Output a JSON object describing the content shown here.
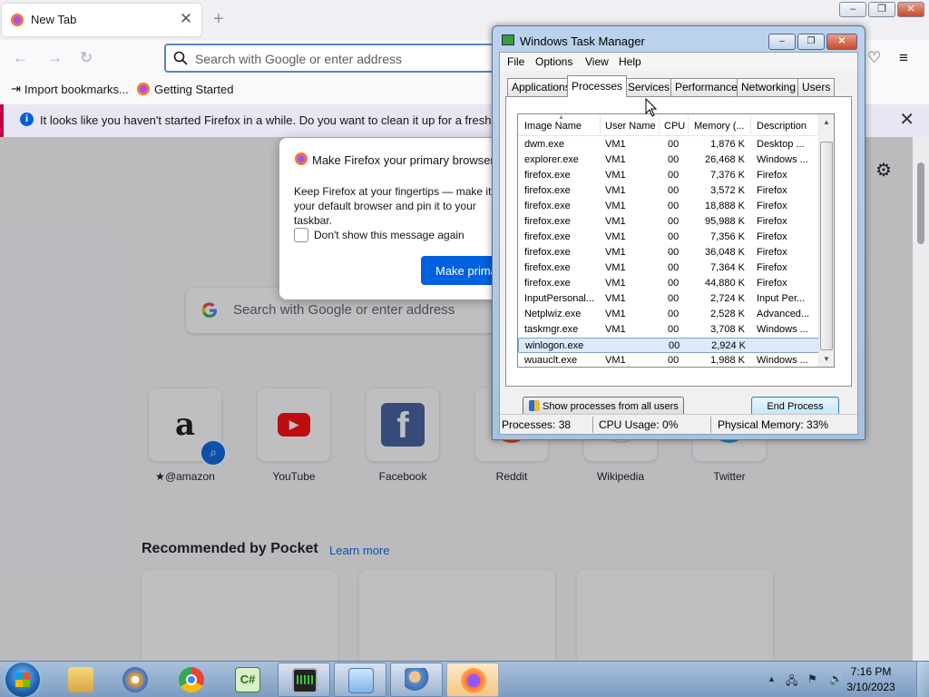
{
  "browser": {
    "tab_title": "New Tab",
    "url_placeholder": "Search with Google or enter address",
    "bookmarks": [
      {
        "label": "Import bookmarks..."
      },
      {
        "label": "Getting Started"
      }
    ],
    "notification": "It looks like you haven't started Firefox in a while. Do you want to clean it up for a fresh, like-new",
    "home_search_placeholder": "Search with Google or enter address",
    "top_sites": [
      {
        "label": "@amazon",
        "icon": "amazon-logo"
      },
      {
        "label": "YouTube",
        "icon": "youtube-logo"
      },
      {
        "label": "Facebook",
        "icon": "facebook-logo"
      },
      {
        "label": "Reddit",
        "icon": "reddit-logo"
      },
      {
        "label": "Wikipedia",
        "icon": "wikipedia-logo"
      },
      {
        "label": "Twitter",
        "icon": "twitter-logo"
      }
    ],
    "pocket": {
      "heading": "Recommended by Pocket",
      "learn_more": "Learn more"
    },
    "dialog": {
      "title": "Make Firefox your primary browser?",
      "body": "Keep Firefox at your fingertips — make it your default browser and pin it to your taskbar.",
      "checkbox_label": "Don't show this message again",
      "primary_button": "Make primary browser"
    }
  },
  "task_manager": {
    "title": "Windows Task Manager",
    "menu": [
      "File",
      "Options",
      "View",
      "Help"
    ],
    "tabs": [
      "Applications",
      "Processes",
      "Services",
      "Performance",
      "Networking",
      "Users"
    ],
    "active_tab": "Processes",
    "columns": [
      "Image Name",
      "User Name",
      "CPU",
      "Memory (...",
      "Description"
    ],
    "processes": [
      {
        "name": "dwm.exe",
        "user": "VM1",
        "cpu": "00",
        "memory": "1,876 K",
        "description": "Desktop ..."
      },
      {
        "name": "explorer.exe",
        "user": "VM1",
        "cpu": "00",
        "memory": "26,468 K",
        "description": "Windows ..."
      },
      {
        "name": "firefox.exe",
        "user": "VM1",
        "cpu": "00",
        "memory": "7,376 K",
        "description": "Firefox"
      },
      {
        "name": "firefox.exe",
        "user": "VM1",
        "cpu": "00",
        "memory": "3,572 K",
        "description": "Firefox"
      },
      {
        "name": "firefox.exe",
        "user": "VM1",
        "cpu": "00",
        "memory": "18,888 K",
        "description": "Firefox"
      },
      {
        "name": "firefox.exe",
        "user": "VM1",
        "cpu": "00",
        "memory": "95,988 K",
        "description": "Firefox"
      },
      {
        "name": "firefox.exe",
        "user": "VM1",
        "cpu": "00",
        "memory": "7,356 K",
        "description": "Firefox"
      },
      {
        "name": "firefox.exe",
        "user": "VM1",
        "cpu": "00",
        "memory": "36,048 K",
        "description": "Firefox"
      },
      {
        "name": "firefox.exe",
        "user": "VM1",
        "cpu": "00",
        "memory": "7,364 K",
        "description": "Firefox"
      },
      {
        "name": "firefox.exe",
        "user": "VM1",
        "cpu": "00",
        "memory": "44,880 K",
        "description": "Firefox"
      },
      {
        "name": "InputPersonal...",
        "user": "VM1",
        "cpu": "00",
        "memory": "2,724 K",
        "description": "Input Per..."
      },
      {
        "name": "Netplwiz.exe",
        "user": "VM1",
        "cpu": "00",
        "memory": "2,528 K",
        "description": "Advanced..."
      },
      {
        "name": "taskmgr.exe",
        "user": "VM1",
        "cpu": "00",
        "memory": "3,708 K",
        "description": "Windows ..."
      },
      {
        "name": "winlogon.exe",
        "user": "",
        "cpu": "00",
        "memory": "2,924 K",
        "description": "",
        "selected": true
      },
      {
        "name": "wuauclt.exe",
        "user": "VM1",
        "cpu": "00",
        "memory": "1,988 K",
        "description": "Windows ..."
      }
    ],
    "show_all_button": "Show processes from all users",
    "end_process_button": "End Process",
    "status": {
      "processes": "Processes: 38",
      "cpu": "CPU Usage: 0%",
      "memory": "Physical Memory: 33%"
    }
  },
  "taskbar": {
    "apps": [
      "start-orb",
      "explorer",
      "media-player",
      "chrome",
      "csharp-editor",
      "remote-desktop",
      "control-panel",
      "user-accounts",
      "firefox"
    ],
    "clock": {
      "time": "7:16 PM",
      "date": "3/10/2023"
    }
  },
  "colors": {
    "accent": "#0061e0",
    "selection": "#dce9f8",
    "infobar_stripe": "#c50042"
  }
}
